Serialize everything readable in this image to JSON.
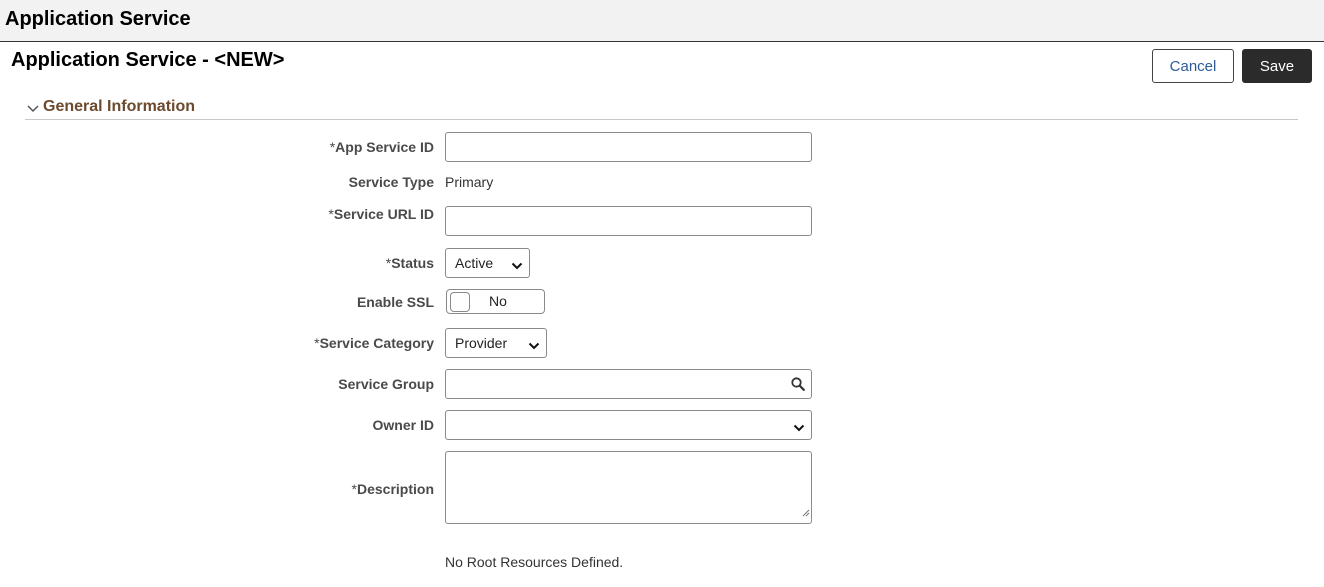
{
  "header": {
    "title": "Application Service"
  },
  "page": {
    "title": "Application Service - <NEW>"
  },
  "toolbar": {
    "cancel_label": "Cancel",
    "save_label": "Save"
  },
  "section": {
    "title": "General Information",
    "icon": "chevron-down-icon"
  },
  "form": {
    "app_service_id": {
      "label": "App Service ID",
      "required": "*",
      "value": ""
    },
    "service_type": {
      "label": "Service Type",
      "value": "Primary"
    },
    "service_url_id": {
      "label": "Service URL ID",
      "required": "*",
      "value": ""
    },
    "status": {
      "label": "Status",
      "required": "*",
      "value": "Active"
    },
    "enable_ssl": {
      "label": "Enable SSL",
      "value": "No"
    },
    "service_category": {
      "label": "Service Category",
      "required": "*",
      "value": "Provider"
    },
    "service_group": {
      "label": "Service Group",
      "value": "",
      "icon": "search-icon"
    },
    "owner_id": {
      "label": "Owner ID",
      "value": ""
    },
    "description": {
      "label": "Description",
      "required": "*",
      "value": ""
    }
  },
  "root_resources": {
    "message": "No Root Resources Defined."
  },
  "colors": {
    "accent_text": "#2e5c9a",
    "save_bg": "#2b2b2b",
    "section_title": "#6b4a2d",
    "topbar_bg": "#f2f2f2"
  }
}
